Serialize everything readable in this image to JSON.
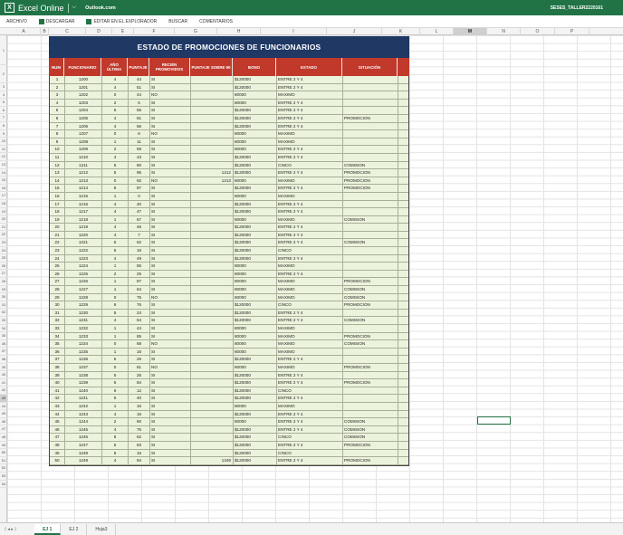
{
  "app": {
    "title": "Excel Online",
    "outlook": "Outlook.com",
    "filename": "SESES_TALLER2220161"
  },
  "ribbon": {
    "items": [
      "ARCHIVO",
      "DESCARGAR",
      "EDITAR EN EL EXPLORADOR",
      "BUSCAR",
      "COMENTARIOS"
    ]
  },
  "columns": [
    "A",
    "B",
    "C",
    "D",
    "E",
    "F",
    "G",
    "H",
    "I",
    "J",
    "K",
    "L",
    "M",
    "N",
    "O",
    "P"
  ],
  "selected_cell": "M43",
  "table": {
    "title": "ESTADO DE PROMOCIONES DE FUNCIONARIOS",
    "headers": [
      "NUM",
      "FUNCIONARIO",
      "AÑO ÚLTIMA",
      "PUNTAJE",
      "RECIÉN PROMOVIDOS",
      "PUNTAJE SOBRE 90",
      "BONO",
      "ESTADO",
      "SITUACIÓN"
    ],
    "rows": [
      [
        "1",
        "1200",
        "4",
        "44",
        "SI",
        "",
        "$120000",
        "ENTRE 2 Y 4",
        ""
      ],
      [
        "2",
        "1201",
        "4",
        "51",
        "SI",
        "",
        "$120000",
        "ENTRE 2 Y 4",
        ""
      ],
      [
        "3",
        "1202",
        "0",
        "44",
        "NO",
        "",
        "80000",
        "MAXIMO",
        ""
      ],
      [
        "4",
        "1203",
        "2",
        "5",
        "SI",
        "",
        "80000",
        "ENTRE 2 Y 4",
        ""
      ],
      [
        "5",
        "1204",
        "5",
        "55",
        "SI",
        "",
        "$120000",
        "ENTRE 2 Y 4",
        ""
      ],
      [
        "6",
        "1205",
        "4",
        "81",
        "SI",
        "",
        "$120000",
        "ENTRE 2 Y 4",
        "PROMOCION"
      ],
      [
        "7",
        "1206",
        "4",
        "56",
        "SI",
        "",
        "$120000",
        "ENTRE 2 Y 4",
        ""
      ],
      [
        "8",
        "1207",
        "0",
        "6",
        "NO",
        "",
        "80000",
        "MAXIMO",
        ""
      ],
      [
        "9",
        "1208",
        "1",
        "11",
        "SI",
        "",
        "80000",
        "MAXIMO",
        ""
      ],
      [
        "10",
        "1209",
        "2",
        "59",
        "SI",
        "",
        "80000",
        "ENTRE 2 Y 4",
        ""
      ],
      [
        "11",
        "1210",
        "4",
        "43",
        "SI",
        "",
        "$120000",
        "ENTRE 2 Y 4",
        ""
      ],
      [
        "12",
        "1211",
        "6",
        "80",
        "SI",
        "",
        "$120000",
        "CINCO",
        "COMISION"
      ],
      [
        "13",
        "1212",
        "5",
        "95",
        "SI",
        "1212",
        "$120000",
        "ENTRE 2 Y 4",
        "PROMOCION"
      ],
      [
        "14",
        "1213",
        "0",
        "92",
        "NO",
        "1213",
        "80000",
        "MAXIMO",
        "PROMOCION"
      ],
      [
        "15",
        "1214",
        "5",
        "87",
        "SI",
        "",
        "$120000",
        "ENTRE 2 Y 4",
        "PROMOCION"
      ],
      [
        "16",
        "1215",
        "1",
        "0",
        "SI",
        "",
        "80000",
        "MAXIMO",
        ""
      ],
      [
        "17",
        "1216",
        "4",
        "40",
        "SI",
        "",
        "$120000",
        "ENTRE 2 Y 4",
        ""
      ],
      [
        "18",
        "1217",
        "4",
        "47",
        "SI",
        "",
        "$120000",
        "ENTRE 2 Y 4",
        ""
      ],
      [
        "19",
        "1218",
        "1",
        "67",
        "SI",
        "",
        "80000",
        "MAXIMO",
        "COMISION"
      ],
      [
        "20",
        "1219",
        "4",
        "46",
        "SI",
        "",
        "$120000",
        "ENTRE 2 Y 4",
        ""
      ],
      [
        "21",
        "1220",
        "4",
        "7",
        "SI",
        "",
        "$120000",
        "ENTRE 2 Y 4",
        ""
      ],
      [
        "22",
        "1221",
        "5",
        "62",
        "SI",
        "",
        "$120000",
        "ENTRE 2 Y 4",
        "COMISION"
      ],
      [
        "23",
        "1222",
        "5",
        "16",
        "SI",
        "",
        "$120000",
        "CINCO",
        ""
      ],
      [
        "24",
        "1223",
        "4",
        "49",
        "SI",
        "",
        "$120000",
        "ENTRE 2 Y 4",
        ""
      ],
      [
        "25",
        "1224",
        "1",
        "55",
        "SI",
        "",
        "80000",
        "MAXIMO",
        ""
      ],
      [
        "26",
        "1225",
        "2",
        "25",
        "SI",
        "",
        "80000",
        "ENTRE 2 Y 4",
        ""
      ],
      [
        "27",
        "1226",
        "1",
        "87",
        "SI",
        "",
        "80000",
        "MAXIMO",
        "PROMOCION"
      ],
      [
        "28",
        "1227",
        "1",
        "64",
        "SI",
        "",
        "80000",
        "MAXIMO",
        "COMISION"
      ],
      [
        "29",
        "1228",
        "0",
        "75",
        "NO",
        "",
        "80000",
        "MAXIMO",
        "COMISION"
      ],
      [
        "30",
        "1229",
        "6",
        "76",
        "SI",
        "",
        "$120000",
        "CINCO",
        "PROMOCION"
      ],
      [
        "31",
        "1230",
        "5",
        "24",
        "SI",
        "",
        "$120000",
        "ENTRE 2 Y 4",
        ""
      ],
      [
        "32",
        "1231",
        "4",
        "64",
        "SI",
        "",
        "$120000",
        "ENTRE 2 Y 4",
        "COMISION"
      ],
      [
        "33",
        "1232",
        "1",
        "44",
        "SI",
        "",
        "80000",
        "MAXIMO",
        ""
      ],
      [
        "34",
        "1233",
        "1",
        "85",
        "SI",
        "",
        "80000",
        "MAXIMO",
        "PROMOCION"
      ],
      [
        "35",
        "1234",
        "0",
        "68",
        "NO",
        "",
        "80000",
        "MAXIMO",
        "COMISION"
      ],
      [
        "36",
        "1235",
        "1",
        "16",
        "SI",
        "",
        "80000",
        "MAXIMO",
        ""
      ],
      [
        "37",
        "1236",
        "5",
        "26",
        "SI",
        "",
        "$120000",
        "ENTRE 2 Y 4",
        ""
      ],
      [
        "38",
        "1237",
        "0",
        "81",
        "NO",
        "",
        "80000",
        "MAXIMO",
        "PROMOCION"
      ],
      [
        "39",
        "1238",
        "5",
        "25",
        "SI",
        "",
        "$120000",
        "ENTRE 2 Y 4",
        ""
      ],
      [
        "40",
        "1239",
        "5",
        "84",
        "SI",
        "",
        "$120000",
        "ENTRE 2 Y 4",
        "PROMOCION"
      ],
      [
        "41",
        "1240",
        "6",
        "12",
        "SI",
        "",
        "$120000",
        "CINCO",
        ""
      ],
      [
        "42",
        "1241",
        "5",
        "40",
        "SI",
        "",
        "$120000",
        "ENTRE 2 Y 4",
        ""
      ],
      [
        "43",
        "1242",
        "1",
        "15",
        "SI",
        "",
        "80000",
        "MAXIMO",
        ""
      ],
      [
        "44",
        "1243",
        "4",
        "16",
        "SI",
        "",
        "$120000",
        "ENTRE 2 Y 4",
        ""
      ],
      [
        "45",
        "1244",
        "2",
        "60",
        "SI",
        "",
        "80000",
        "ENTRE 2 Y 4",
        "COMISION"
      ],
      [
        "46",
        "1245",
        "4",
        "75",
        "SI",
        "",
        "$120000",
        "ENTRE 2 Y 4",
        "COMISION"
      ],
      [
        "47",
        "1246",
        "6",
        "62",
        "SI",
        "",
        "$120000",
        "CINCO",
        "COMISION"
      ],
      [
        "48",
        "1247",
        "5",
        "83",
        "SI",
        "",
        "$120000",
        "ENTRE 2 Y 4",
        "PROMOCION"
      ],
      [
        "49",
        "1248",
        "6",
        "15",
        "SI",
        "",
        "$120000",
        "CINCO",
        ""
      ],
      [
        "50",
        "1249",
        "4",
        "94",
        "SI",
        "1249",
        "$120000",
        "ENTRE 2 Y 4",
        "PROMOCION"
      ]
    ]
  },
  "tabs": {
    "items": [
      "EJ 1",
      "EJ 2",
      "Hoja3"
    ],
    "active": 0
  }
}
